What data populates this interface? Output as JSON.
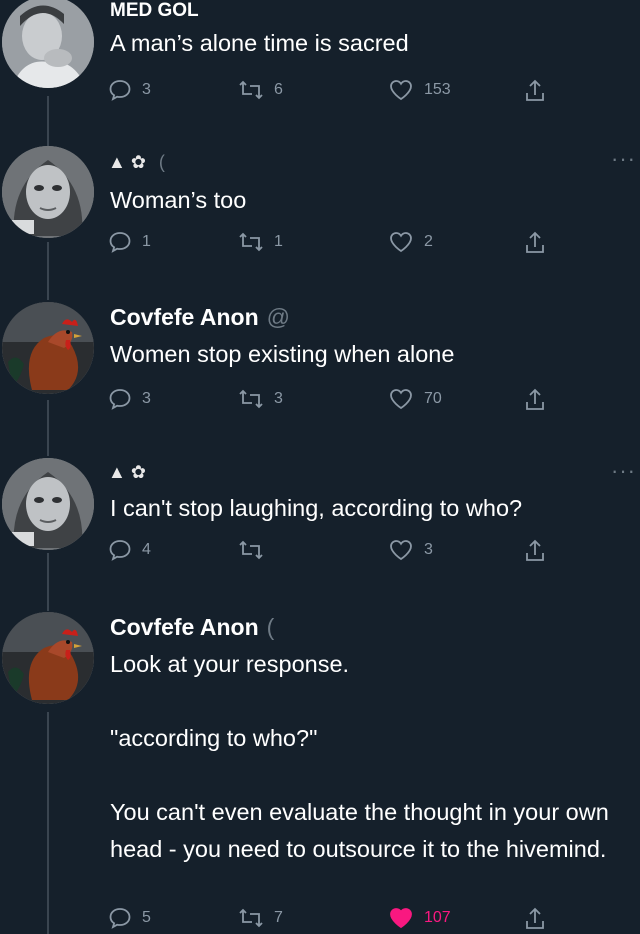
{
  "theme": {
    "background": "#15202b",
    "text": "#ffffff",
    "muted": "#8b98a5",
    "like_active": "#f91880"
  },
  "tweets": [
    {
      "name": "MED GOL",
      "handle": "",
      "text": "A man’s alone time is sacred",
      "replies": "3",
      "retweets": "6",
      "likes": "153",
      "liked": false,
      "avatar": "man-portrait"
    },
    {
      "name": "",
      "handle": "(",
      "emoji_name": "▲ ✿",
      "text": "Woman’s too",
      "replies": "1",
      "retweets": "1",
      "likes": "2",
      "liked": false,
      "avatar": "woman-portrait"
    },
    {
      "name": "Covfefe Anon",
      "handle": "@",
      "text": "Women stop existing when alone",
      "replies": "3",
      "retweets": "3",
      "likes": "70",
      "liked": false,
      "avatar": "rooster"
    },
    {
      "name": "",
      "handle": "",
      "emoji_name": "▲ ✿",
      "text": "I can't stop laughing, according to who?",
      "replies": "4",
      "retweets": "",
      "likes": "3",
      "liked": false,
      "avatar": "woman-portrait"
    },
    {
      "name": "Covfefe Anon",
      "handle": "(",
      "text": "Look at your response.\n\n\"according to who?\"\n\nYou can't even evaluate the thought in your own head - you need to outsource it to the hivemind.",
      "replies": "5",
      "retweets": "7",
      "likes": "107",
      "liked": true,
      "avatar": "rooster"
    }
  ],
  "more_label": "···"
}
